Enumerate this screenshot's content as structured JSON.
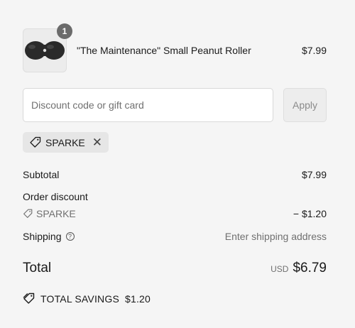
{
  "product": {
    "name": "\"The Maintenance\" Small Peanut Roller",
    "price": "$7.99",
    "quantity": "1",
    "thumbnail_icon": "peanut-roller-image"
  },
  "discount": {
    "placeholder": "Discount code or gift card",
    "value": "",
    "apply_label": "Apply"
  },
  "applied_code": {
    "code": "SPARKE",
    "remove_icon": "close-icon"
  },
  "summary": {
    "subtotal_label": "Subtotal",
    "subtotal_value": "$7.99",
    "order_discount_label": "Order discount",
    "discount_code": "SPARKE",
    "discount_value": "− $1.20",
    "shipping_label": "Shipping",
    "shipping_value": "Enter shipping address",
    "total_label": "Total",
    "currency": "USD",
    "total_value": "$6.79",
    "savings_label": "TOTAL SAVINGS",
    "savings_value": "$1.20"
  }
}
